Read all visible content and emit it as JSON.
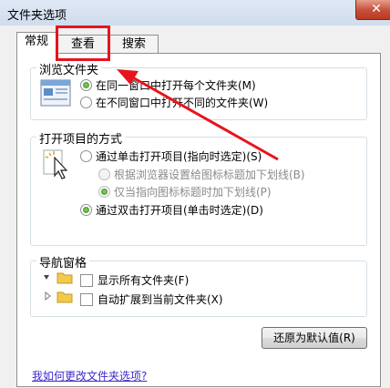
{
  "window": {
    "title": "文件夹选项",
    "close_symbol": "✕"
  },
  "tabs": [
    {
      "label": "常规",
      "active": true
    },
    {
      "label": "查看",
      "active": false
    },
    {
      "label": "搜索",
      "active": false
    }
  ],
  "browse_folders": {
    "title": "浏览文件夹",
    "options": [
      {
        "label": "在同一窗口中打开每个文件夹(M)",
        "selected": true
      },
      {
        "label": "在不同窗口中打开不同的文件夹(W)",
        "selected": false
      }
    ]
  },
  "click_items": {
    "title": "打开项目的方式",
    "single_click": "通过单击打开项目(指向时选定)(S)",
    "underline_browser": "根据浏览器设置给图标标题加下划线(B)",
    "underline_point": "仅当指向图标标题时加下划线(P)",
    "double_click": "通过双击打开项目(单击时选定)(D)"
  },
  "navigation_pane": {
    "title": "导航窗格",
    "show_all_folders": "显示所有文件夹(F)",
    "auto_expand": "自动扩展到当前文件夹(X)"
  },
  "restore_button": "还原为默认值(R)",
  "help_link": "我如何更改文件夹选项?",
  "annotation": {
    "highlight_color": "#e8131c"
  }
}
